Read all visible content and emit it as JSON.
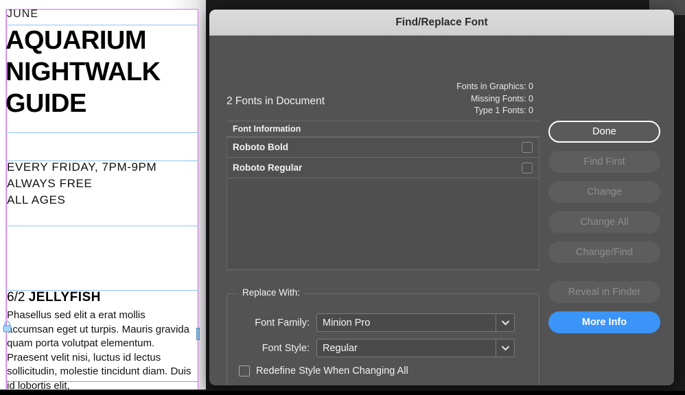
{
  "document": {
    "kicker": "JUNE",
    "headline": "AQUARIUM NIGHTWALK GUIDE",
    "details": "EVERY FRIDAY, 7PM-9PM\nALWAYS FREE\nALL AGES",
    "entry_date": "6/2",
    "entry_title": "JELLYFISH",
    "body": "Phasellus sed elit a erat mollis accumsan eget ut turpis. Mauris gravida quam porta volutpat elementum. Praesent velit nisi, luctus id lectus sollicitudin, molestie tincidunt diam. Duis id lobortis elit,",
    "lock_icon": "lock-icon"
  },
  "dialog": {
    "title": "Find/Replace Font",
    "summary": {
      "count": "2 Fonts in Document",
      "stats": [
        "Fonts in Graphics: 0",
        "Missing Fonts: 0",
        "Type 1 Fonts: 0"
      ]
    },
    "list": {
      "header": "Font Information",
      "rows": [
        {
          "label": "Roboto Bold",
          "checked": false
        },
        {
          "label": "Roboto Regular",
          "checked": false
        }
      ]
    },
    "replace": {
      "legend": "Replace With:",
      "family_label": "Font Family:",
      "family_value": "Minion Pro",
      "style_label": "Font Style:",
      "style_value": "Regular",
      "redefine_label": "Redefine Style When Changing All",
      "redefine_checked": false,
      "dropdown_icon": "chevron-down-icon"
    },
    "buttons": [
      {
        "label": "Done",
        "state": "default"
      },
      {
        "label": "Find First",
        "state": "disabled"
      },
      {
        "label": "Change",
        "state": "disabled"
      },
      {
        "label": "Change All",
        "state": "disabled"
      },
      {
        "label": "Change/Find",
        "state": "disabled"
      },
      {
        "label": "Reveal in Finder",
        "state": "disabled"
      },
      {
        "label": "More Info",
        "state": "primary"
      }
    ]
  },
  "colors": {
    "dialog_body": "#535353",
    "titlebar": "#d5d5d5",
    "primary_button": "#3b94f7",
    "guide_magenta": "#d86ef5",
    "guide_blue": "#8fc4f0"
  }
}
